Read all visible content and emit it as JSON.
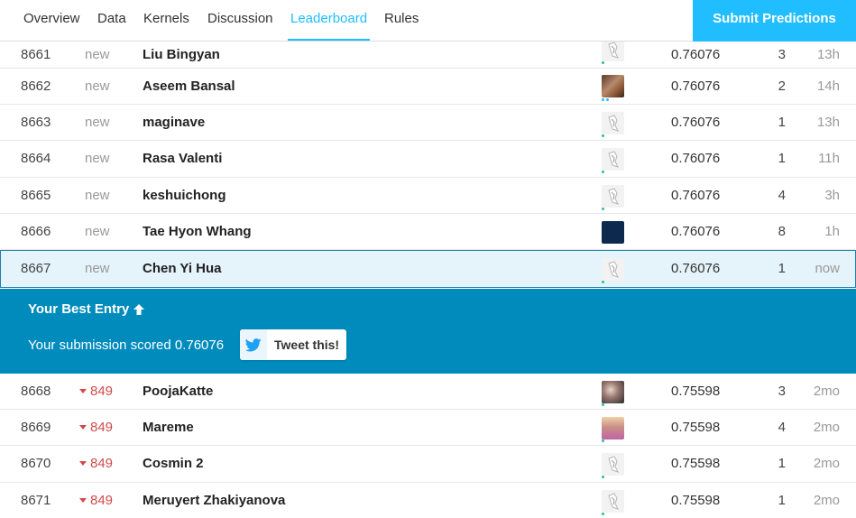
{
  "nav": {
    "tabs": [
      {
        "label": "Overview",
        "active": false
      },
      {
        "label": "Data",
        "active": false
      },
      {
        "label": "Kernels",
        "active": false
      },
      {
        "label": "Discussion",
        "active": false
      },
      {
        "label": "Leaderboard",
        "active": true
      },
      {
        "label": "Rules",
        "active": false
      }
    ],
    "submit_label": "Submit Predictions"
  },
  "colors": {
    "accent": "#20beff",
    "banner": "#008bbd",
    "rank_down": "#d24b4b"
  },
  "rows_top": [
    {
      "rank": "8661",
      "change": "new",
      "name": "Liu Bingyan",
      "avatar": "default-avatar-icon",
      "score": "0.76076",
      "entries": "3",
      "last": "13h"
    },
    {
      "rank": "8662",
      "change": "new",
      "name": "Aseem Bansal",
      "avatar": "user-photo",
      "score": "0.76076",
      "entries": "2",
      "last": "14h"
    },
    {
      "rank": "8663",
      "change": "new",
      "name": "maginave",
      "avatar": "default-avatar-icon",
      "score": "0.76076",
      "entries": "1",
      "last": "13h"
    },
    {
      "rank": "8664",
      "change": "new",
      "name": "Rasa Valenti",
      "avatar": "default-avatar-icon",
      "score": "0.76076",
      "entries": "1",
      "last": "11h"
    },
    {
      "rank": "8665",
      "change": "new",
      "name": "keshuichong",
      "avatar": "default-avatar-icon",
      "score": "0.76076",
      "entries": "4",
      "last": "3h"
    },
    {
      "rank": "8666",
      "change": "new",
      "name": "Tae Hyon Whang",
      "avatar": "navy-avatar",
      "score": "0.76076",
      "entries": "8",
      "last": "1h"
    },
    {
      "rank": "8667",
      "change": "new",
      "name": "Chen Yi Hua",
      "avatar": "default-avatar-icon",
      "score": "0.76076",
      "entries": "1",
      "last": "now"
    }
  ],
  "best_entry": {
    "title": "Your Best Entry",
    "title_icon": "arrow-up-icon",
    "text": "Your submission scored 0.76076",
    "tweet_label": "Tweet this!",
    "tweet_icon": "twitter-icon"
  },
  "rows_bottom": [
    {
      "rank": "8668",
      "change": "849",
      "change_dir": "down",
      "name": "PoojaKatte",
      "avatar": "user-photo",
      "score": "0.75598",
      "entries": "3",
      "last": "2mo"
    },
    {
      "rank": "8669",
      "change": "849",
      "change_dir": "down",
      "name": "Mareme",
      "avatar": "user-photo",
      "score": "0.75598",
      "entries": "4",
      "last": "2mo"
    },
    {
      "rank": "8670",
      "change": "849",
      "change_dir": "down",
      "name": "Cosmin 2",
      "avatar": "default-avatar-icon",
      "score": "0.75598",
      "entries": "1",
      "last": "2mo"
    },
    {
      "rank": "8671",
      "change": "849",
      "change_dir": "down",
      "name": "Meruyert Zhakiyanova",
      "avatar": "default-avatar-icon",
      "score": "0.75598",
      "entries": "1",
      "last": "2mo"
    }
  ]
}
